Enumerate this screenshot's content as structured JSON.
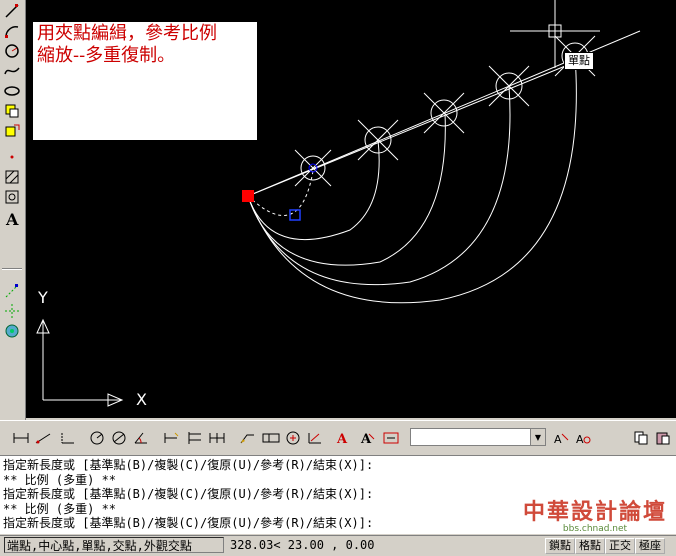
{
  "note": {
    "line1": "用夾點編緝，參考比例",
    "line2": "縮放--多重復制。"
  },
  "snap_tooltip": "單點",
  "ucs": {
    "x_label": "X",
    "y_label": "Y"
  },
  "command_lines": [
    "指定新長度或 [基準點(B)/複製(C)/復原(U)/參考(R)/結束(X)]:",
    "** 比例 (多重) **",
    "指定新長度或 [基準點(B)/複製(C)/復原(U)/參考(R)/結束(X)]:",
    "** 比例 (多重) **",
    "指定新長度或 [基準點(B)/複製(C)/復原(U)/參考(R)/結束(X)]:"
  ],
  "status": {
    "osnap": "端點,中心點,單點,交點,外觀交點",
    "coordinates": "328.03<  23.00  , 0.00",
    "toggles": [
      "鎖點",
      "格點",
      "正交",
      "極座"
    ]
  },
  "watermark": {
    "title": "中華設計論壇",
    "url": "bbs.chnad.net"
  },
  "colors": {
    "drawing_bg": "#000000",
    "grip_hot": "#ff0000",
    "grip_cold": "#0000ff",
    "note_text": "#cc0000"
  },
  "left_toolbar_icons": [
    "line-icon",
    "arc-icon",
    "circle-icon",
    "spline-icon",
    "ellipse-icon",
    "insert-block-icon",
    "make-block-icon",
    "point-icon",
    "hatch-icon",
    "region-icon",
    "text-icon"
  ],
  "left_toolbar2_icons": [
    "snap-endpoint-icon",
    "snap-midpoint-icon",
    "snap-center-icon"
  ]
}
